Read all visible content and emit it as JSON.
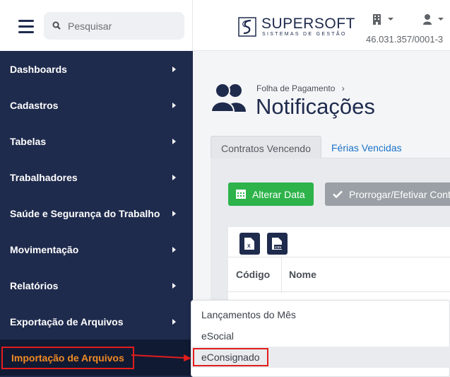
{
  "search": {
    "placeholder": "Pesquisar"
  },
  "sidebar": {
    "items": [
      {
        "label": "Dashboards"
      },
      {
        "label": "Cadastros"
      },
      {
        "label": "Tabelas"
      },
      {
        "label": "Trabalhadores"
      },
      {
        "label": "Saúde e Segurança do Trabalho"
      },
      {
        "label": "Movimentação"
      },
      {
        "label": "Relatórios"
      },
      {
        "label": "Exportação de Arquivos"
      },
      {
        "label": "Importação de Arquivos"
      }
    ]
  },
  "header": {
    "brand": "SUPERSOFT",
    "tagline": "SISTEMAS DE GESTÃO",
    "cnpj": "46.031.357/0001-3"
  },
  "breadcrumb": {
    "parent": "Folha de Pagamento",
    "separator": "›"
  },
  "page": {
    "title": "Notificações"
  },
  "tabs": [
    {
      "label": "Contratos Vencendo"
    },
    {
      "label": "Férias Vencidas"
    }
  ],
  "actions": {
    "alter_date": "Alterar Data",
    "extend": "Prorrogar/Efetivar Cont"
  },
  "table": {
    "columns": [
      "Código",
      "Nome"
    ]
  },
  "submenu": {
    "items": [
      {
        "label": "Lançamentos do Mês"
      },
      {
        "label": "eSocial"
      },
      {
        "label": "eConsignado"
      }
    ]
  },
  "colors": {
    "sidebar_bg": "#1f2b4d",
    "highlight_red": "#e11d1d",
    "active_orange": "#f08a24",
    "button_green": "#2db34a"
  },
  "icons": [
    "menu-icon",
    "search-icon",
    "company-icon",
    "user-icon",
    "users-icon",
    "calendar-icon",
    "check-icon",
    "excel-icon",
    "csv-icon"
  ]
}
